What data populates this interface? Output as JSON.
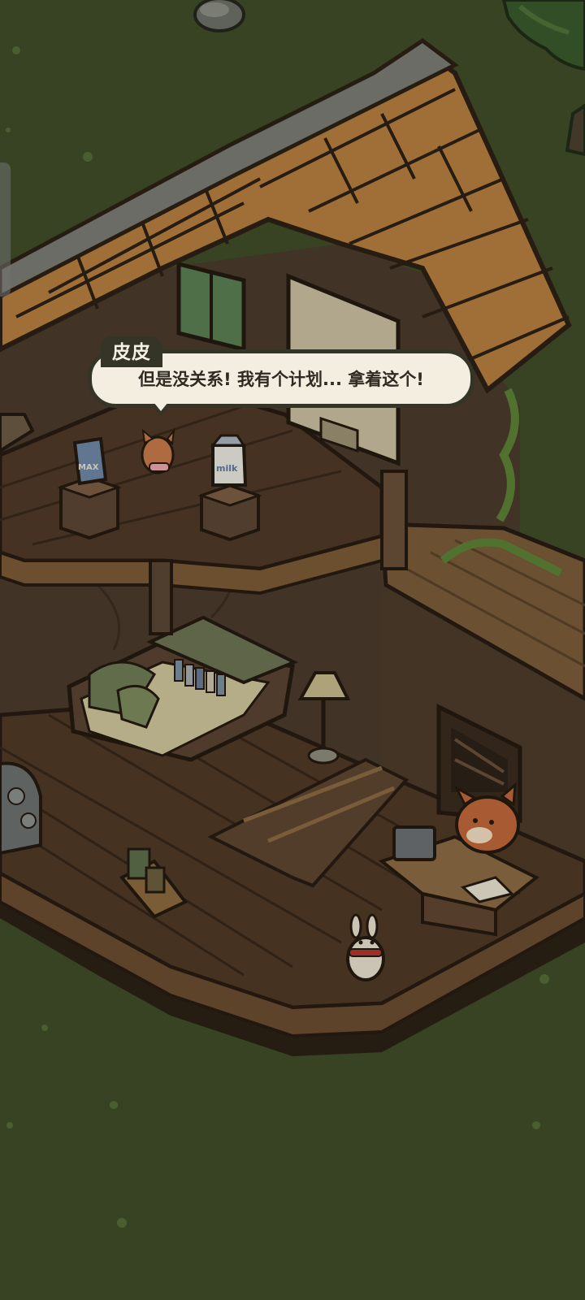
{
  "dialog": {
    "speaker": "皮皮",
    "text": "但是没关系! 我有个计划... 拿着这个!"
  },
  "props": {
    "milk_label": "milk",
    "snack_label": "MAX"
  },
  "colors": {
    "grass": "#3f4d27",
    "wood_dark": "#332517",
    "wood_mid": "#503a26",
    "roof": "#b57f3f",
    "bubble_fill": "#f3eee0",
    "bubble_border": "#353527"
  }
}
